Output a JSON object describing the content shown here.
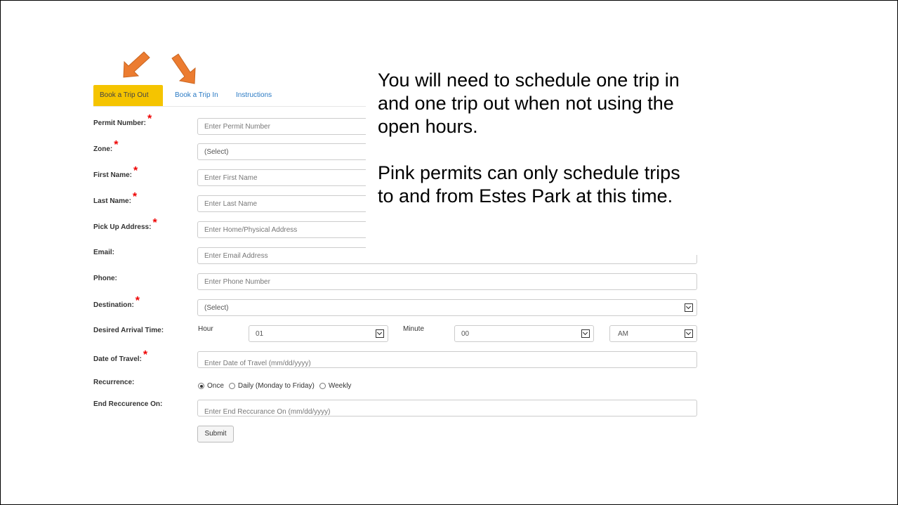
{
  "tabs": [
    {
      "label": "Book a Trip Out",
      "active": true
    },
    {
      "label": "Book a Trip In",
      "active": false
    },
    {
      "label": "Instructions",
      "active": false
    }
  ],
  "form": {
    "permit_number": {
      "label": "Permit Number:",
      "required": true,
      "placeholder": "Enter Permit Number"
    },
    "zone": {
      "label": "Zone:",
      "required": true,
      "value": "(Select)"
    },
    "first_name": {
      "label": "First Name:",
      "required": true,
      "placeholder": "Enter First Name"
    },
    "last_name": {
      "label": "Last Name:",
      "required": true,
      "placeholder": "Enter Last Name"
    },
    "pickup_address": {
      "label": "Pick Up Address:",
      "required": true,
      "placeholder": "Enter Home/Physical Address"
    },
    "email": {
      "label": "Email:",
      "required": false,
      "placeholder": "Enter Email Address"
    },
    "phone": {
      "label": "Phone:",
      "required": false,
      "placeholder": "Enter Phone Number"
    },
    "destination": {
      "label": "Destination:",
      "required": true,
      "value": "(Select)"
    },
    "arrival_time": {
      "label": "Desired Arrival Time:",
      "hour_label": "Hour",
      "hour_value": "01",
      "minute_label": "Minute",
      "minute_value": "00",
      "ampm_value": "AM"
    },
    "date_of_travel": {
      "label": "Date of Travel:",
      "required": true,
      "placeholder": "Enter Date of Travel (mm/dd/yyyy)"
    },
    "recurrence": {
      "label": "Recurrence:",
      "options": [
        "Once",
        "Daily (Monday to Friday)",
        "Weekly"
      ],
      "selected": "Once"
    },
    "end_recurrence": {
      "label": "End Reccurence On:",
      "placeholder": "Enter End Reccurance On (mm/dd/yyyy)"
    },
    "submit_label": "Submit",
    "required_mark": "*"
  },
  "overlay": {
    "paragraph1": "You will need to schedule one trip in and one trip out when not using the open hours.",
    "paragraph2": "Pink permits can only schedule trips to and from Estes Park at this time."
  },
  "colors": {
    "active_tab": "#f5c400",
    "arrow": "#ec7c30",
    "link": "#2a7ac4",
    "required": "#e00000"
  },
  "icons": [
    "arrow-down-left-icon",
    "arrow-down-right-icon",
    "chevron-down-icon"
  ]
}
